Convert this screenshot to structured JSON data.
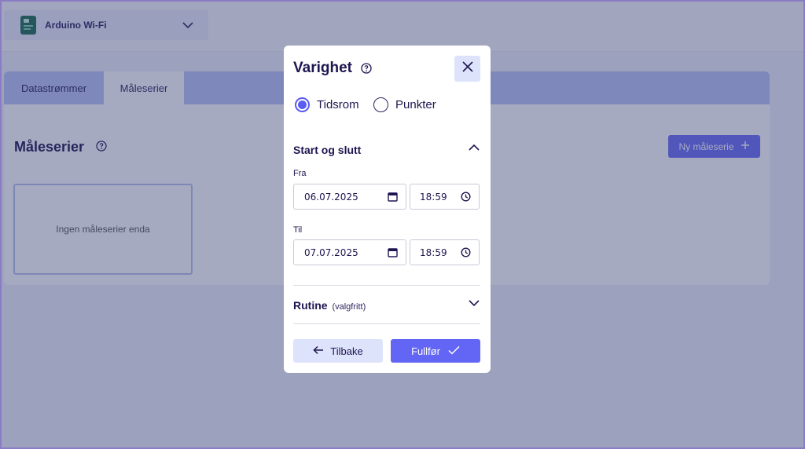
{
  "device": {
    "name": "Arduino Wi-Fi",
    "icon": "board-icon"
  },
  "tabs": [
    {
      "label": "Datastrømmer",
      "active": false
    },
    {
      "label": "Måleserier",
      "active": true
    }
  ],
  "section": {
    "title": "Måleserier",
    "new_button": "Ny måleserie",
    "empty_text": "Ingen måleserier enda"
  },
  "modal": {
    "title": "Varighet",
    "radio_options": [
      {
        "label": "Tidsrom",
        "checked": true
      },
      {
        "label": "Punkter",
        "checked": false
      }
    ],
    "start_end": {
      "title": "Start og slutt",
      "from_label": "Fra",
      "from_date": "06.07.2025",
      "from_time": "18:59",
      "to_label": "Til",
      "to_date": "07.07.2025",
      "to_time": "18:59"
    },
    "routine": {
      "title": "Rutine",
      "optional": "(valgfritt)"
    },
    "back_button": "Tilbake",
    "finish_button": "Fullfør"
  },
  "colors": {
    "primary": "#6366f5",
    "primary_light": "#dde3fb",
    "text_dark": "#1e1650",
    "overlay": "#303a6c"
  }
}
